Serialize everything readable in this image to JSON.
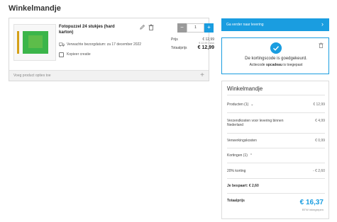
{
  "page": {
    "title": "Winkelmandje"
  },
  "item": {
    "title": "Fotopuzzel 24 stukjes (hard karton)",
    "delivery": "Verwachte bezorgdatum: za 17 december 2022",
    "copy": "Kopieer creatie",
    "quantity": "1",
    "price_label": "Prijs",
    "price_value": "€ 12,99",
    "price_sub": "€ 12,99 / stuk",
    "total_label": "Totaalprijs",
    "total_value": "€ 12,99"
  },
  "options": {
    "label": "Voeg product opties toe",
    "plus": "+"
  },
  "continue": {
    "label": "Ga verder naar levering",
    "arrow": "›"
  },
  "discount": {
    "message": "De kortingscode is goedgekeurd.",
    "code_prefix": "Actiecode",
    "code": "spcadeau",
    "code_suffix": "is toegepast"
  },
  "summary": {
    "title": "Winkelmandje",
    "products_label": "Producten (1)",
    "products_value": "€ 12,99",
    "shipping_label": "Verzendkosten voor levering binnen Nederland",
    "shipping_value": "€ 4,99",
    "handling_label": "Verwerkingskosten",
    "handling_value": "€ 0,99",
    "discounts_label": "Kortingen (1)",
    "discount_name": "20% korting",
    "discount_value": "- € 2,60",
    "saved_label": "Je bespaart: € 2,60",
    "total_label": "Totaalprijs",
    "total_value": "€ 16,37",
    "vat_label": "BTW inbegrepen"
  },
  "colors": {
    "accent": "#1a9de0",
    "minus": "#9a9a9a"
  },
  "icons": [
    "edit-icon",
    "trash-icon",
    "truck-icon",
    "copy-icon",
    "plus-icon",
    "chevron-right-icon",
    "check-icon",
    "chevron-down-icon",
    "chevron-up-icon"
  ]
}
